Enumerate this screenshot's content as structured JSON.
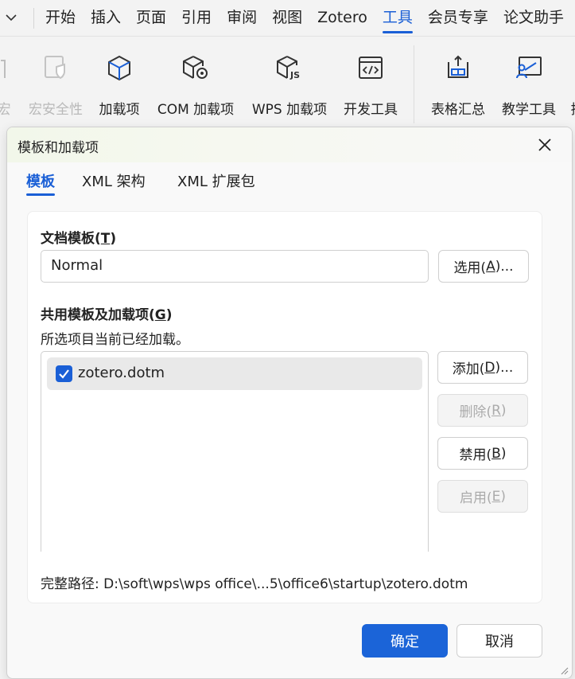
{
  "menubar": {
    "tabs": [
      {
        "label": "开始"
      },
      {
        "label": "插入"
      },
      {
        "label": "页面"
      },
      {
        "label": "引用"
      },
      {
        "label": "审阅"
      },
      {
        "label": "视图"
      },
      {
        "label": "Zotero"
      },
      {
        "label": "工具",
        "active": true
      },
      {
        "label": "会员专享"
      },
      {
        "label": "论文助手"
      }
    ]
  },
  "toolbar": {
    "items": [
      {
        "label": "宏",
        "icon": "macro-icon",
        "disabled": true
      },
      {
        "label": "宏安全性",
        "icon": "macro-security-icon",
        "disabled": true
      },
      {
        "label": "加载项",
        "icon": "addin-cube-icon"
      },
      {
        "label": "COM 加载项",
        "icon": "com-addin-icon"
      },
      {
        "label": "WPS 加载项",
        "icon": "wps-js-addin-icon"
      },
      {
        "label": "开发工具",
        "icon": "developer-tools-icon"
      },
      {
        "label": "表格汇总",
        "icon": "table-summary-icon"
      },
      {
        "label": "教学工具",
        "icon": "teaching-tools-icon"
      },
      {
        "label": "排",
        "icon": "more-tool-icon"
      }
    ]
  },
  "dialog": {
    "title": "模板和加载项",
    "tabs": [
      {
        "label": "模板",
        "active": true
      },
      {
        "label": "XML 架构"
      },
      {
        "label": "XML 扩展包"
      }
    ],
    "document_template": {
      "label": "文档模板(",
      "label_key": "T",
      "label_end": ")",
      "value": "Normal",
      "select_button": {
        "text": "选用(",
        "key": "A",
        "end": ")..."
      }
    },
    "global_templates": {
      "label": "共用模板及加载项(",
      "label_key": "G",
      "label_end": ")",
      "hint": "所选项目当前已经加载。",
      "items": [
        {
          "name": "zotero.dotm",
          "checked": true
        }
      ],
      "buttons": {
        "add": {
          "text": "添加(",
          "key": "D",
          "end": ")...",
          "disabled": false
        },
        "remove": {
          "text": "删除(",
          "key": "R",
          "end": ")",
          "disabled": true
        },
        "disable": {
          "text": "禁用(",
          "key": "B",
          "end": ")",
          "disabled": false
        },
        "enable": {
          "text": "启用(",
          "key": "E",
          "end": ")",
          "disabled": true
        }
      }
    },
    "full_path": "完整路径: D:\\soft\\wps\\wps office\\...5\\office6\\startup\\zotero.dotm",
    "ok_label": "确定",
    "cancel_label": "取消"
  },
  "colors": {
    "accent": "#1a5fd6",
    "primary_button": "#1b64d8",
    "disabled_text": "#ababab"
  }
}
